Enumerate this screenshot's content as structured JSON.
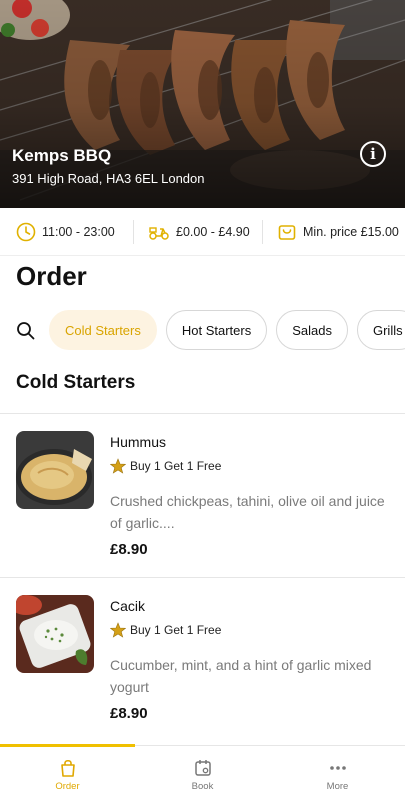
{
  "restaurant": {
    "name": "Kemps BBQ",
    "address": "391 High Road, HA3 6EL London"
  },
  "info_strip": {
    "hours": "11:00 - 23:00",
    "delivery_fee": "£0.00 - £4.90",
    "min_price": "Min. price £15.00"
  },
  "page_title": "Order",
  "categories": [
    {
      "label": "Cold Starters",
      "active": true
    },
    {
      "label": "Hot Starters",
      "active": false
    },
    {
      "label": "Salads",
      "active": false
    },
    {
      "label": "Grills",
      "active": false
    }
  ],
  "section_title": "Cold Starters",
  "items": [
    {
      "name": "Hummus",
      "promo": "Buy 1 Get 1 Free",
      "description": "Crushed chickpeas, tahini, olive oil and juice of garlic....",
      "price": "£8.90"
    },
    {
      "name": "Cacik",
      "promo": "Buy 1 Get 1 Free",
      "description": "Cucumber, mint, and a hint of garlic mixed yogurt",
      "price": "£8.90"
    }
  ],
  "nav": [
    {
      "label": "Order",
      "icon": "bag-icon",
      "active": true
    },
    {
      "label": "Book",
      "icon": "calendar-icon",
      "active": false
    },
    {
      "label": "More",
      "icon": "more-dots-icon",
      "active": false
    }
  ],
  "colors": {
    "accent": "#f0c000",
    "chip_active_bg": "#fdf3e1",
    "chip_active_text": "#d9a400"
  }
}
